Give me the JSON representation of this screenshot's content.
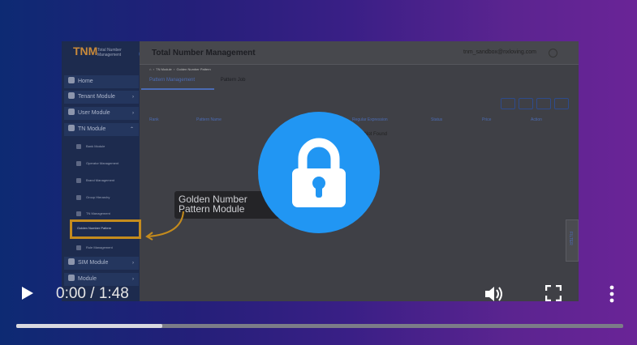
{
  "app": {
    "logo_text": "TNM",
    "logo_subtitle": "Total Number Management",
    "title": "Total Number Management",
    "user_email": "tnm_sandbox@nxloving.com"
  },
  "breadcrumb": [
    "TN Module",
    "Golden Number Pattern"
  ],
  "tabs": [
    "Pattern Management",
    "Pattern Job"
  ],
  "sidebar": {
    "items": [
      "Home",
      "Tenant Module",
      "User Module",
      "TN Module",
      "SIM Module",
      "Module"
    ],
    "sub_items": [
      "Bank Module",
      "Operator Management",
      "Brand Management",
      "Group Hierarchy",
      "TN Management",
      "Golden Number Pattern",
      "Rule Management"
    ]
  },
  "table": {
    "columns": [
      "Rank",
      "Pattern Name",
      "Regular Expression",
      "Status",
      "Price",
      "Action"
    ],
    "empty_text": "Not Found"
  },
  "filter_label": "FILTER",
  "callout": "Golden Number Pattern Module",
  "player": {
    "current": "0:00",
    "duration": "1:48",
    "time_text": "0:00 / 1:48",
    "buffered_fraction": 0.24
  },
  "colors": {
    "lock": "#2196f3",
    "highlight": "#c48b1d"
  }
}
